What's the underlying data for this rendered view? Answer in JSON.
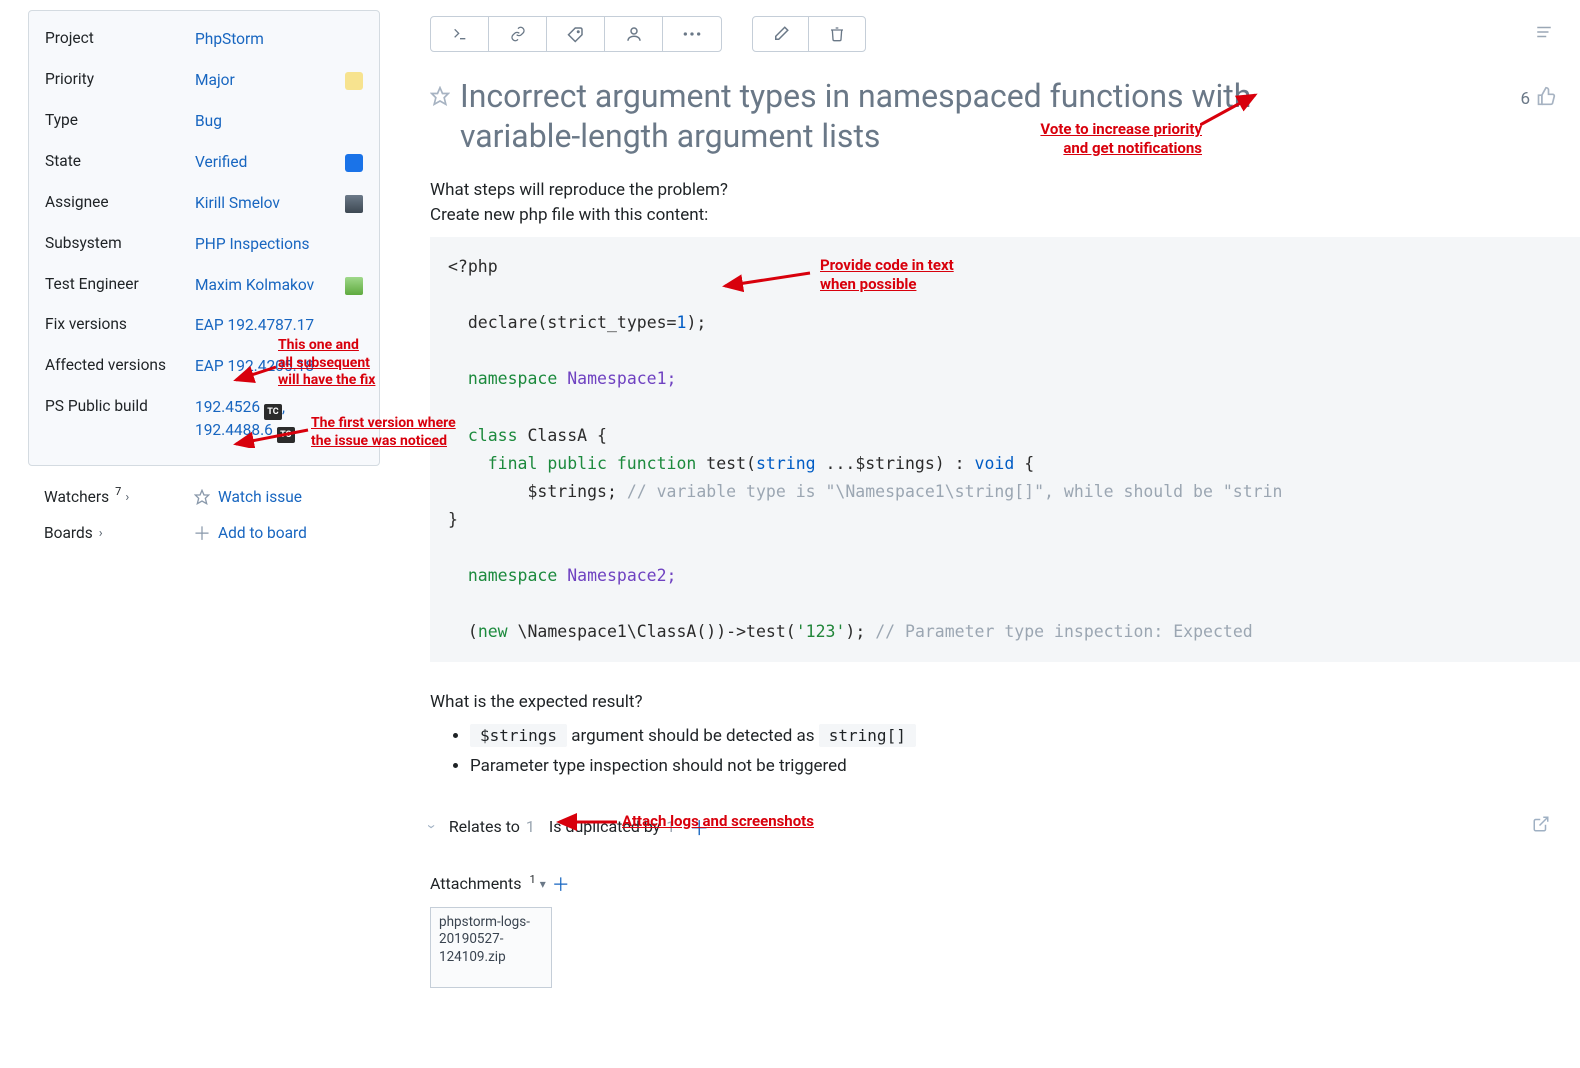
{
  "sidebar": {
    "fields": {
      "project": {
        "label": "Project",
        "value": "PhpStorm"
      },
      "priority": {
        "label": "Priority",
        "value": "Major"
      },
      "type": {
        "label": "Type",
        "value": "Bug"
      },
      "state": {
        "label": "State",
        "value": "Verified"
      },
      "assignee": {
        "label": "Assignee",
        "value": "Kirill Smelov"
      },
      "subsystem": {
        "label": "Subsystem",
        "value": "PHP Inspections"
      },
      "test_engineer": {
        "label": "Test Engineer",
        "value": "Maxim Kolmakov"
      },
      "fix_versions": {
        "label": "Fix versions",
        "value": "EAP 192.4787.17"
      },
      "affected_versions": {
        "label": "Affected versions",
        "value": "EAP 192.4205.18"
      },
      "ps_public_build": {
        "label": "PS Public build",
        "value1": "192.4526",
        "value2": "192.4488.6",
        "tc": "TC"
      }
    },
    "watchers": {
      "label": "Watchers",
      "count": "7",
      "action": "Watch issue"
    },
    "boards": {
      "label": "Boards",
      "action": "Add to board"
    }
  },
  "issue": {
    "title": "Incorrect argument types in namespaced functions with variable-length argument lists",
    "vote_count": "6",
    "desc_line1": "What steps will reproduce the problem?",
    "desc_line2": "Create new php file with this content:",
    "code": {
      "l1": "<?php",
      "l2a": "declare",
      "l2b": "(strict_types=",
      "l2c": "1",
      "l2d": ");",
      "l3a": "namespace",
      "l3b": " Namespace1;",
      "l4a": "class",
      "l4b": " ClassA {",
      "l5a": "    final public function",
      "l5b": " test(",
      "l5c": "string",
      "l5d": " ...$strings) : ",
      "l5e": "void",
      "l5f": " {",
      "l6a": "        $strings; ",
      "l6b": "// variable type is \"\\Namespace1\\string[]\", while should be \"strin",
      "l7": "}",
      "l8a": "namespace",
      "l8b": " Namespace2;",
      "l9a": "(",
      "l9b": "new",
      "l9c": " \\Namespace1\\ClassA())->test(",
      "l9d": "'123'",
      "l9e": "); ",
      "l9f": "// Parameter type inspection: Expected"
    },
    "expected_title": "What is the expected result?",
    "expected_item1a": "$strings",
    "expected_item1b": " argument should be detected as ",
    "expected_item1c": "string[]",
    "expected_item2": "Parameter type inspection should not be triggered",
    "relations": {
      "relates_label": "Relates to",
      "relates_count": "1",
      "dup_label": "Is duplicated by",
      "dup_count": "1"
    },
    "attachments": {
      "label": "Attachments",
      "count": "1",
      "file": "phpstorm-logs-20190527-124109.zip"
    }
  },
  "annotations": {
    "vote": "Vote to increase priority\nand get notifications",
    "code": "Provide code in text\nwhen possible",
    "fix": "This one and\nall subsequent\nwill have the fix",
    "affected": "The first version where\nthe issue was noticed",
    "attach": "Attach logs and screenshots"
  }
}
